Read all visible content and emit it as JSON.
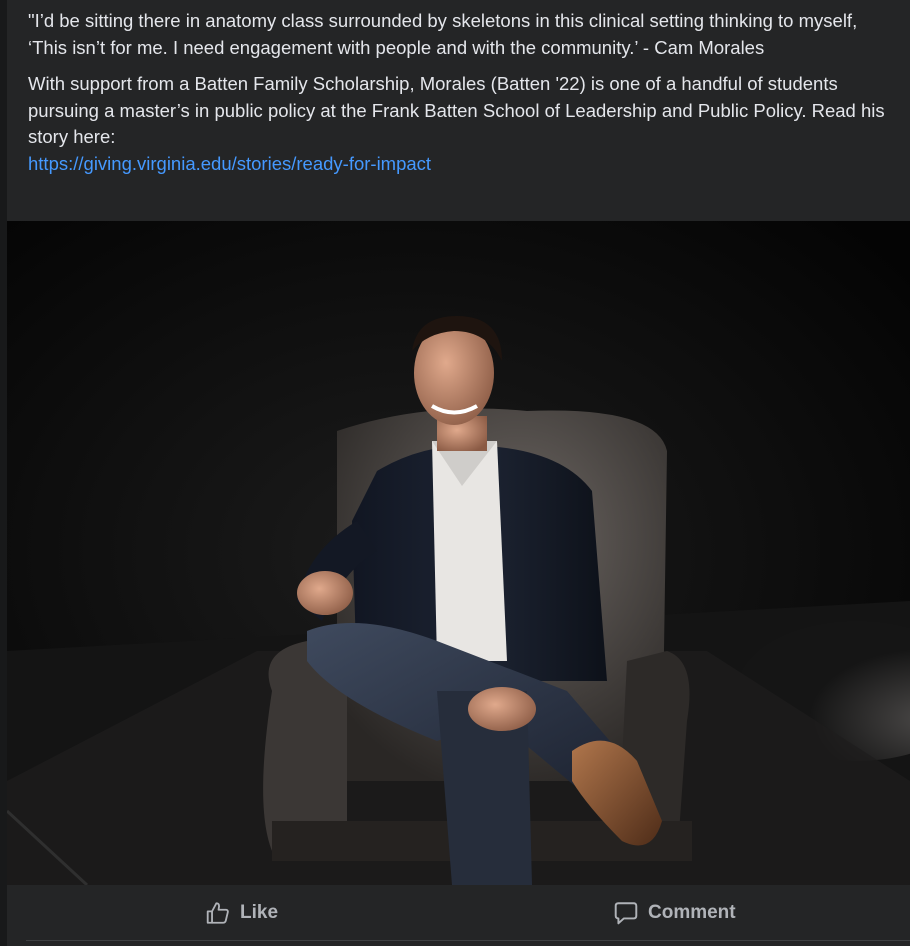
{
  "post": {
    "quote": "\"I’d be sitting there in anatomy class surrounded by skeletons in this clinical setting thinking to myself, ‘This isn’t for me. I need engagement with people and with the community.’ - Cam Morales",
    "body": "With support from a Batten Family Scholarship, Morales (Batten '22) is one of a handful of students pursuing a master’s in public policy at the Frank Batten School of Leadership and Public Policy. Read his story here:",
    "link_text": "https://giving.virginia.edu/stories/ready-for-impact"
  },
  "actions": {
    "like_label": "Like",
    "comment_label": "Comment",
    "like_icon": "thumbs-up-icon",
    "comment_icon": "speech-bubble-icon"
  },
  "colors": {
    "background": "#242526",
    "text": "#e4e6eb",
    "link": "#4599ff",
    "action_text": "#b0b3b8"
  }
}
